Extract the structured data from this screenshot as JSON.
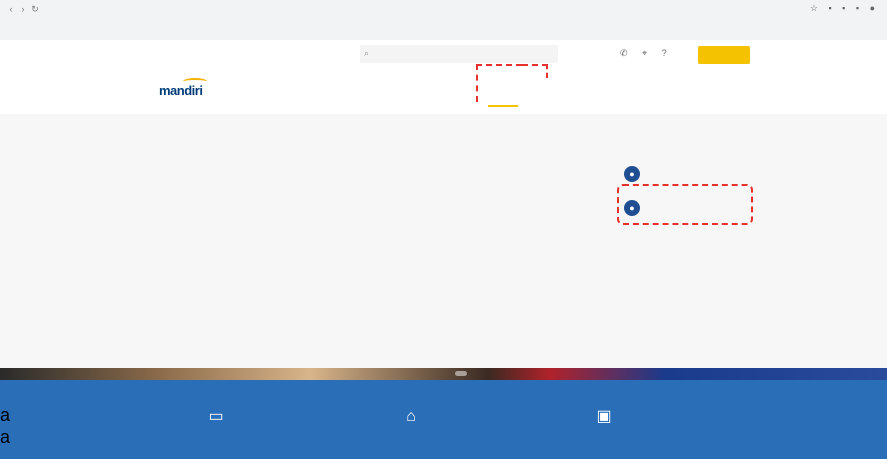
{
  "browser": {
    "url": "",
    "bookmarks": "",
    "reading_list": ""
  },
  "topbar": {
    "lang": "",
    "search_placeholder": "",
    "login_label": ""
  },
  "nav": {
    "logo": "mandiri",
    "links": [
      {
        "label": ""
      },
      {
        "label": ""
      },
      {
        "label": ""
      },
      {
        "label": ""
      },
      {
        "label": ""
      }
    ]
  },
  "mega": {
    "title": "",
    "items": [
      {
        "title": "",
        "desc": ""
      },
      {
        "title": "",
        "desc": ""
      },
      {
        "title": "",
        "desc": ""
      },
      {
        "title": "",
        "desc": ""
      },
      {
        "title": "",
        "desc": ""
      },
      {
        "title": "",
        "desc": ""
      }
    ],
    "quick_actions_title": "",
    "quick_actions": [
      {
        "label": ""
      },
      {
        "label": ""
      }
    ]
  },
  "footer": {
    "items": [
      {
        "title": "",
        "sub": ""
      },
      {
        "title": "",
        "sub": ""
      },
      {
        "title": "",
        "sub": ""
      }
    ]
  },
  "left_edge_text": "a\na"
}
